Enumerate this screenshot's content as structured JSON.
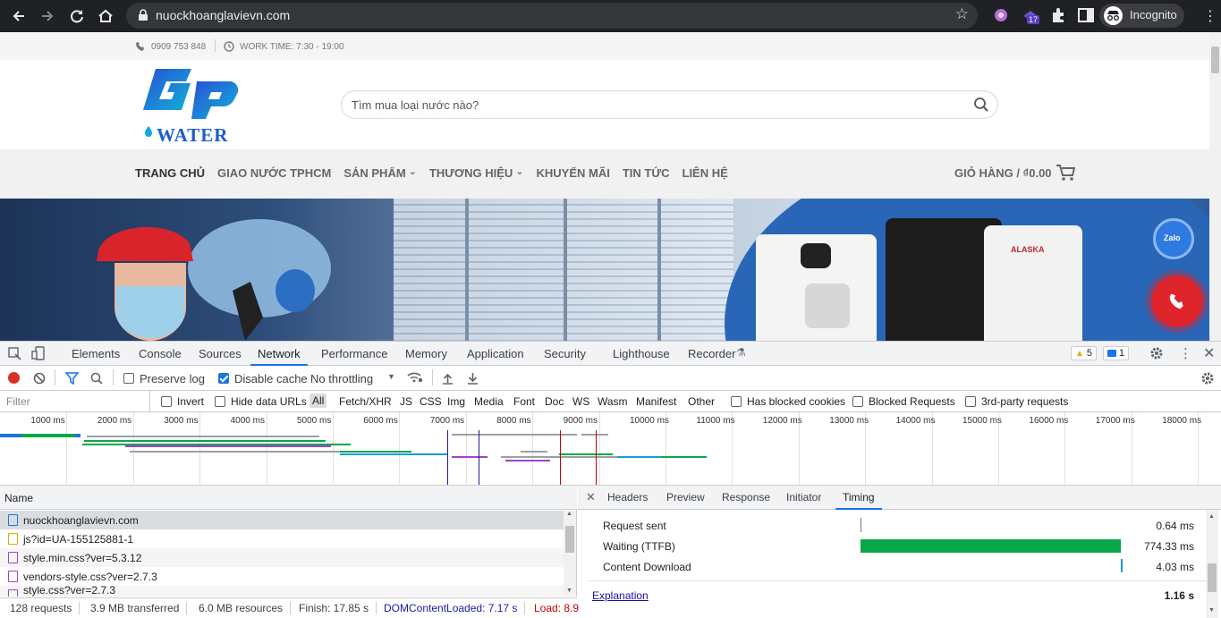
{
  "browser": {
    "url": "nuockhoanglavievn.com",
    "profile_label": "Incognito",
    "extension_badge": "17"
  },
  "site": {
    "topbar": {
      "phone": "0909 753 848",
      "work_time": "WORK TIME: 7:30 - 19:00"
    },
    "logo_text": "WATER",
    "search_placeholder": "Tìm mua loại nước nào?",
    "menu": [
      {
        "label": "TRANG CHỦ"
      },
      {
        "label": "GIAO NƯỚC TPHCM"
      },
      {
        "label": "SẢN PHẨM"
      },
      {
        "label": "THƯƠNG HIỆU"
      },
      {
        "label": "KHUYẾN MÃI"
      },
      {
        "label": "TIN TỨC"
      },
      {
        "label": "LIÊN HỆ"
      }
    ],
    "cart_label": "GIỎ HÀNG / ₫0.00",
    "banner_brand_label": "ALASKA",
    "zalo_label": "Zalo"
  },
  "devtools": {
    "tabs": [
      "Elements",
      "Console",
      "Sources",
      "Network",
      "Performance",
      "Memory",
      "Application",
      "Security",
      "Lighthouse",
      "Recorder"
    ],
    "selected_tab": "Network",
    "warnings_count": "5",
    "messages_count": "1",
    "toolbar": {
      "preserve_log": "Preserve log",
      "disable_cache": "Disable cache",
      "throttling": "No throttling"
    },
    "filter": {
      "placeholder": "Filter",
      "invert": "Invert",
      "hide_data_urls": "Hide data URLs",
      "types": [
        "All",
        "Fetch/XHR",
        "JS",
        "CSS",
        "Img",
        "Media",
        "Font",
        "Doc",
        "WS",
        "Wasm",
        "Manifest",
        "Other"
      ],
      "has_blocked_cookies": "Has blocked cookies",
      "blocked_requests": "Blocked Requests",
      "third_party": "3rd-party requests"
    },
    "timeline_ticks": [
      "1000 ms",
      "2000 ms",
      "3000 ms",
      "4000 ms",
      "5000 ms",
      "6000 ms",
      "7000 ms",
      "8000 ms",
      "9000 ms",
      "10000 ms",
      "11000 ms",
      "12000 ms",
      "13000 ms",
      "14000 ms",
      "15000 ms",
      "16000 ms",
      "17000 ms",
      "18000 ms"
    ],
    "requests_header": "Name",
    "requests": [
      {
        "name": "nuockhoanglavievn.com",
        "type": "doc",
        "selected": true
      },
      {
        "name": "js?id=UA-155125881-1",
        "type": "js"
      },
      {
        "name": "style.min.css?ver=5.3.12",
        "type": "css"
      },
      {
        "name": "vendors-style.css?ver=2.7.3",
        "type": "css"
      },
      {
        "name": "style.css?ver=2.7.3",
        "type": "css"
      }
    ],
    "status": {
      "requests": "128 requests",
      "transferred": "3.9 MB transferred",
      "resources": "6.0 MB resources",
      "finish": "Finish: 17.85 s",
      "dom_content_loaded": "DOMContentLoaded: 7.17 s",
      "load": "Load: 8.9"
    },
    "detail_tabs": [
      "Headers",
      "Preview",
      "Response",
      "Initiator",
      "Timing"
    ],
    "selected_detail_tab": "Timing",
    "timing": [
      {
        "label": "Request sent",
        "value": "0.64 ms"
      },
      {
        "label": "Waiting (TTFB)",
        "value": "774.33 ms"
      },
      {
        "label": "Content Download",
        "value": "4.03 ms"
      }
    ],
    "explanation_link": "Explanation",
    "total_time": "1.16 s"
  },
  "colors": {
    "chrome_bg": "#202124",
    "devtools_accent": "#1a73e8",
    "ttfb_bar": "#0aa74a",
    "dcl_line": "#1a1aa6",
    "load_line": "#c80000"
  }
}
